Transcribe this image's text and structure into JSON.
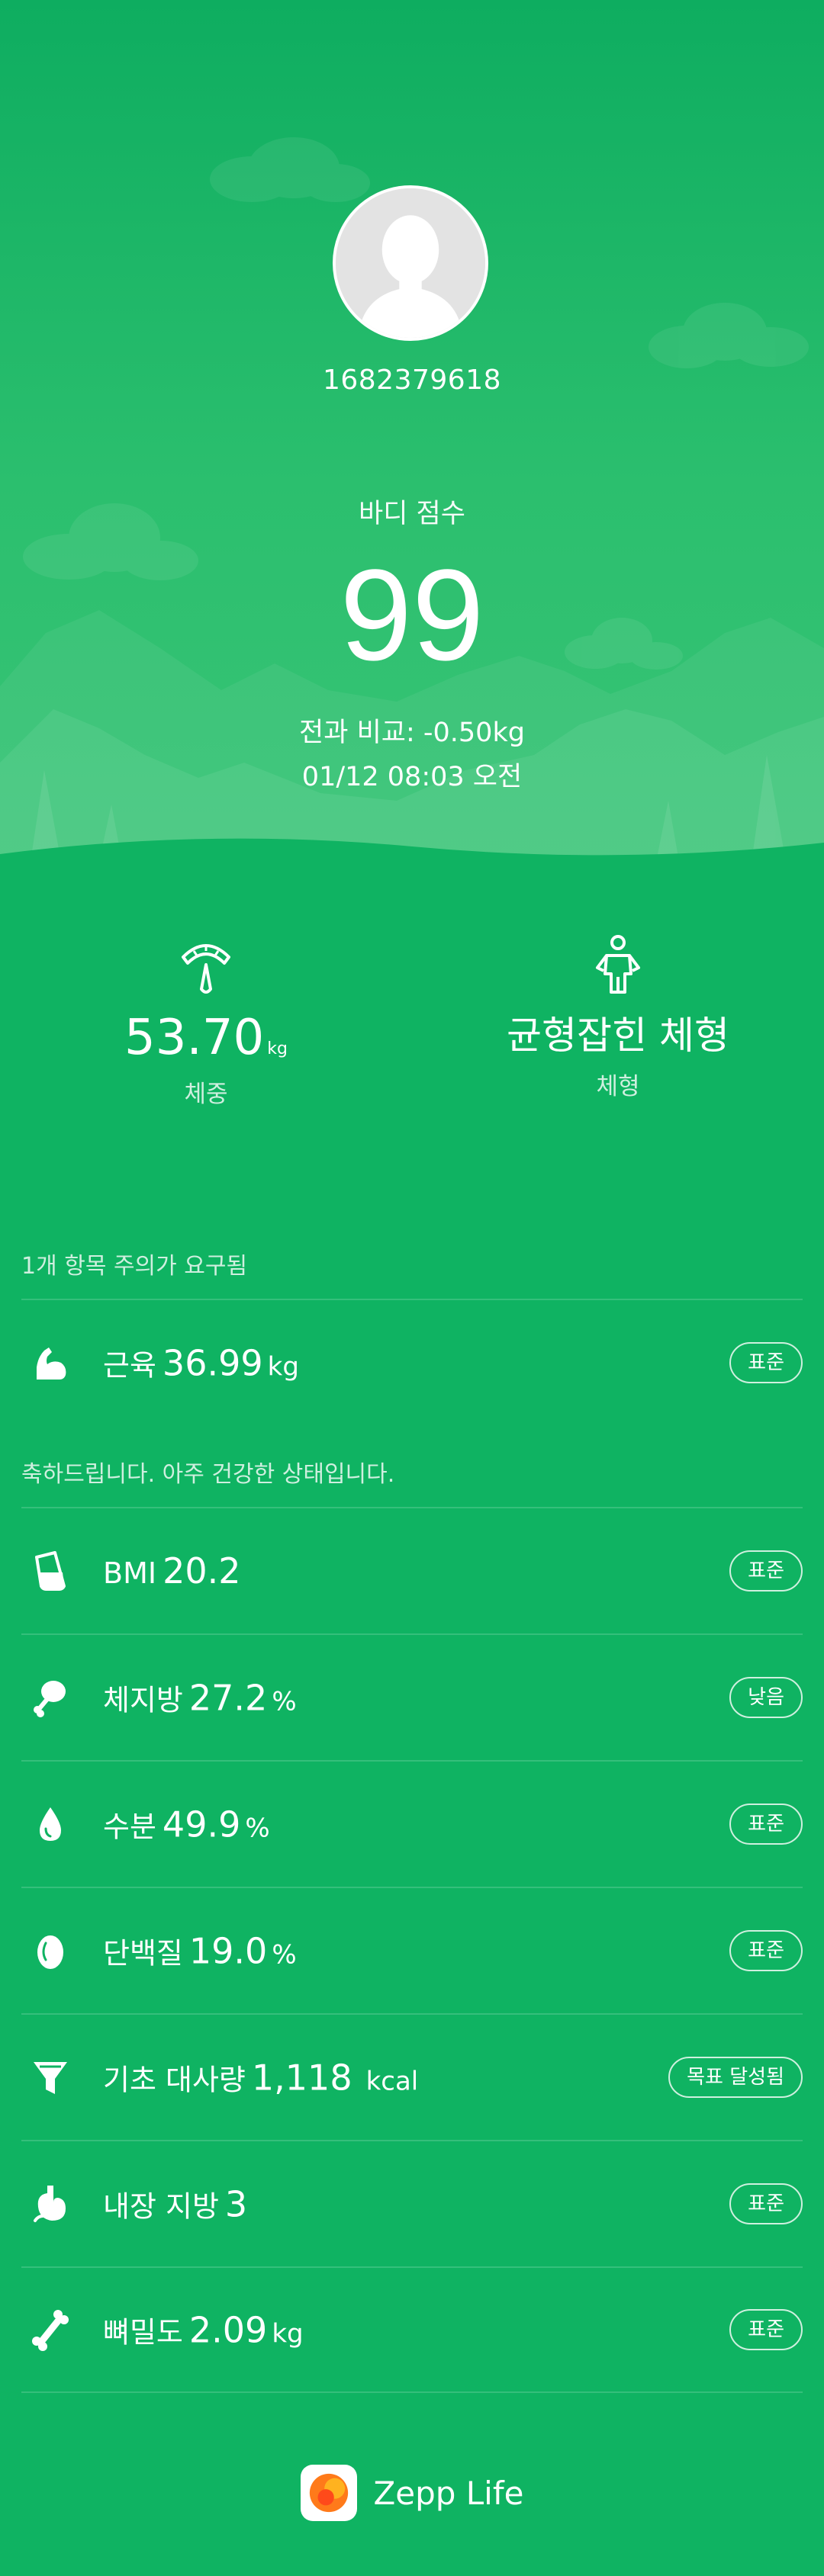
{
  "profile": {
    "user_id": "1682379618"
  },
  "score": {
    "label": "바디 점수",
    "value": "99",
    "comparison": "전과 비교: -0.50kg",
    "datetime": "01/12 08:03 오전"
  },
  "summary": {
    "weight": {
      "value": "53.70",
      "unit": "kg",
      "caption": "체중",
      "icon": "scale-icon"
    },
    "body_type": {
      "value": "균형잡힌 체형",
      "caption": "체형",
      "icon": "body-figure-icon"
    }
  },
  "sections": {
    "attention_note": "1개 항목 주의가 요구됨",
    "healthy_note": "축하드립니다. 아주 건강한 상태입니다."
  },
  "metrics": [
    {
      "name": "근육",
      "value": "36.99",
      "unit": "kg",
      "badge": "표준",
      "icon": "muscle-icon"
    },
    {
      "name": "BMI",
      "value": "20.2",
      "unit": "",
      "badge": "표준",
      "icon": "bmi-cup-icon"
    },
    {
      "name": "체지방",
      "value": "27.2",
      "unit": "%",
      "badge": "낮음",
      "icon": "drumstick-icon"
    },
    {
      "name": "수분",
      "value": "49.9",
      "unit": "%",
      "badge": "표준",
      "icon": "water-drop-icon"
    },
    {
      "name": "단백질",
      "value": "19.0",
      "unit": "%",
      "badge": "표준",
      "icon": "egg-icon"
    },
    {
      "name": "기초 대사량",
      "value": "1,118",
      "unit": "kcal",
      "badge": "목표 달성됨",
      "icon": "funnel-icon"
    },
    {
      "name": "내장 지방",
      "value": "3",
      "unit": "",
      "badge": "표준",
      "icon": "stomach-icon"
    },
    {
      "name": "뼈밀도",
      "value": "2.09",
      "unit": "kg",
      "badge": "표준",
      "icon": "bone-icon"
    }
  ],
  "footer": {
    "brand": "Zepp Life"
  },
  "colors": {
    "background": "#0fb362",
    "hero_top": "#0ead60",
    "brand_orange": "#ff7a1a"
  }
}
